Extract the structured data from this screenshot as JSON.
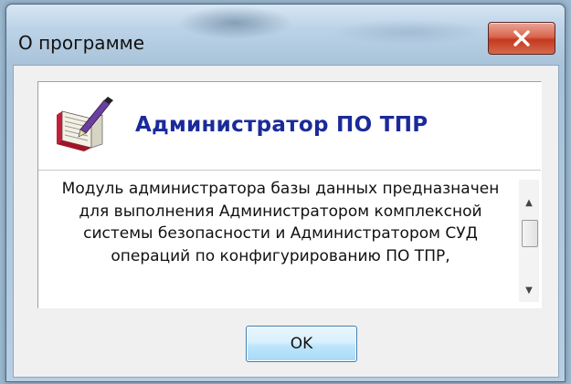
{
  "window": {
    "title": "О программе"
  },
  "about": {
    "app_name": "Администратор ПО ТПР",
    "description": "Модуль администратора базы данных предназначен для выполнения Администратором комплексной системы безопасности и Администратором СУД операций по конфигурированию ПО ТПР,",
    "app_icon": "notebook-pen-icon"
  },
  "buttons": {
    "ok_label": "OK",
    "close_icon": "close-icon"
  },
  "colors": {
    "title_accent": "#1b2a9a",
    "close_button": "#c5391f"
  }
}
